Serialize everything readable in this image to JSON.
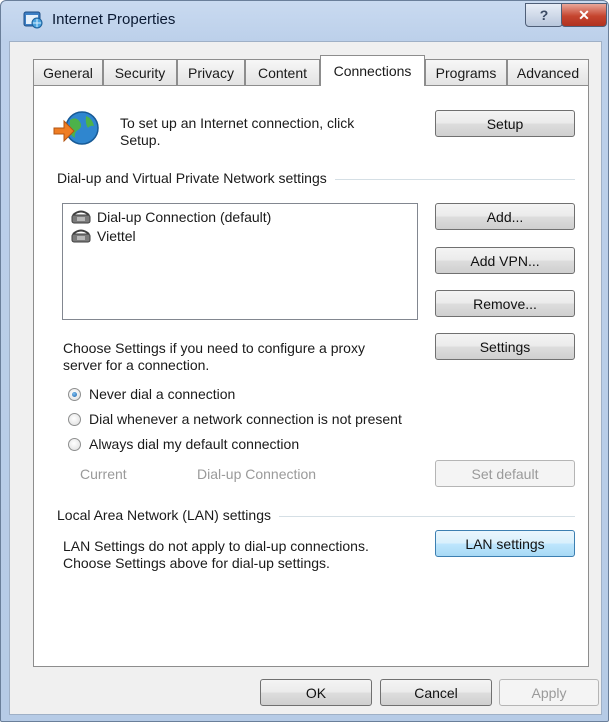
{
  "window": {
    "title": "Internet Properties",
    "help_glyph": "?",
    "close_glyph": "✕"
  },
  "tabs": [
    "General",
    "Security",
    "Privacy",
    "Content",
    "Connections",
    "Programs",
    "Advanced"
  ],
  "active_tab": "Connections",
  "setup": {
    "text_line1": "To set up an Internet connection, click",
    "text_line2": "Setup.",
    "button": "Setup"
  },
  "dialup": {
    "group_label": "Dial-up and Virtual Private Network settings",
    "connections": [
      "Dial-up Connection (default)",
      "Viettel"
    ],
    "add_button": "Add...",
    "add_vpn_button": "Add VPN...",
    "remove_button": "Remove...",
    "proxy_text_line1": "Choose Settings if you need to configure a proxy",
    "proxy_text_line2": "server for a connection.",
    "settings_button": "Settings",
    "options": [
      "Never dial a connection",
      "Dial whenever a network connection is not present",
      "Always dial my default connection"
    ],
    "selected_option": "Never dial a connection",
    "current_label": "Current",
    "current_value": "Dial-up Connection",
    "set_default_button": "Set default"
  },
  "lan": {
    "group_label": "Local Area Network (LAN) settings",
    "text_line1": "LAN Settings do not apply to dial-up connections.",
    "text_line2": "Choose Settings above for dial-up settings.",
    "button": "LAN settings"
  },
  "footer": {
    "ok": "OK",
    "cancel": "Cancel",
    "apply": "Apply"
  }
}
